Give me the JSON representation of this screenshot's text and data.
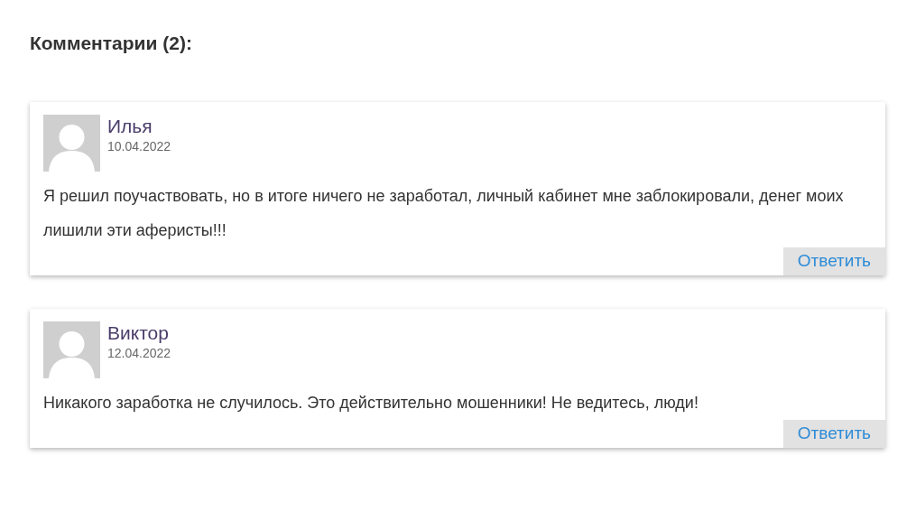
{
  "heading": "Комментарии (2):",
  "comments": [
    {
      "author": "Илья",
      "date": "10.04.2022",
      "text": "Я решил поучаствовать, но в итоге ничего не заработал, личный кабинет мне заблокировали, денег моих лишили эти аферисты!!!",
      "reply": "Ответить"
    },
    {
      "author": "Виктор",
      "date": "12.04.2022",
      "text": "Никакого заработка не случилось. Это действительно мошенники! Не ведитесь, люди!",
      "reply": "Ответить"
    }
  ]
}
